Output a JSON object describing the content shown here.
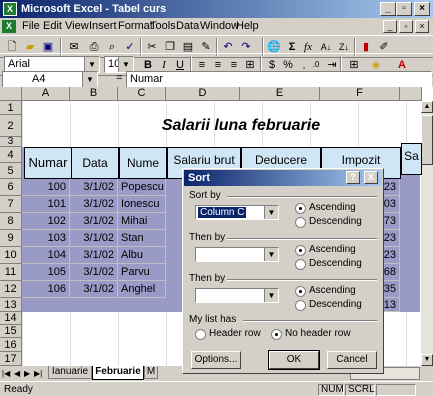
{
  "window": {
    "title": "Microsoft Excel - Tabel curs",
    "app_icon": "excel-icon"
  },
  "menu": [
    "File",
    "Edit",
    "View",
    "Insert",
    "Format",
    "Tools",
    "Data",
    "Window",
    "Help"
  ],
  "font": {
    "name": "Arial",
    "size": "10"
  },
  "formula_bar": {
    "cell_ref": "A4",
    "fx": "=",
    "content": "Numar"
  },
  "columns": [
    "A",
    "B",
    "C",
    "D",
    "E",
    "F"
  ],
  "rows": [
    "1",
    "2",
    "3",
    "4",
    "5",
    "6",
    "7",
    "8",
    "9",
    "10",
    "11",
    "12",
    "13",
    "14",
    "15",
    "16",
    "17"
  ],
  "sheet": {
    "title": "Salarii luna februarie",
    "headers": [
      "Numar",
      "Data",
      "Nume",
      "Salariu brut",
      "Deducere",
      "Impozit",
      "Sa"
    ],
    "data": [
      {
        "numar": "100",
        "data": "3/1/02",
        "nume": "Popescu",
        "f": "23"
      },
      {
        "numar": "101",
        "data": "3/1/02",
        "nume": "Ionescu",
        "f": "03"
      },
      {
        "numar": "102",
        "data": "3/1/02",
        "nume": "Mihai",
        "f": "73"
      },
      {
        "numar": "103",
        "data": "3/1/02",
        "nume": "Stan",
        "f": "23"
      },
      {
        "numar": "104",
        "data": "3/1/02",
        "nume": "Albu",
        "f": "23"
      },
      {
        "numar": "105",
        "data": "3/1/02",
        "nume": "Parvu",
        "f": "68"
      },
      {
        "numar": "106",
        "data": "3/1/02",
        "nume": "Anghel",
        "f": "35"
      }
    ],
    "row13_f": "13"
  },
  "tabs": [
    "Ianuarie",
    "Februarie",
    "M"
  ],
  "status": {
    "text": "Ready",
    "num": "NUM",
    "scrl": "SCRL"
  },
  "dialog": {
    "title": "Sort",
    "help_btn": "?",
    "close_btn": "X",
    "sort_by_label": "Sort by",
    "sort_by_value": "Column C",
    "then_by_label_1": "Then by",
    "then_by_label_2": "Then by",
    "ascending": "Ascending",
    "descending": "Descending",
    "list_has_label": "My list has",
    "header_row": "Header row",
    "no_header_row": "No header row",
    "options_btn": "Options...",
    "ok_btn": "OK",
    "cancel_btn": "Cancel"
  }
}
